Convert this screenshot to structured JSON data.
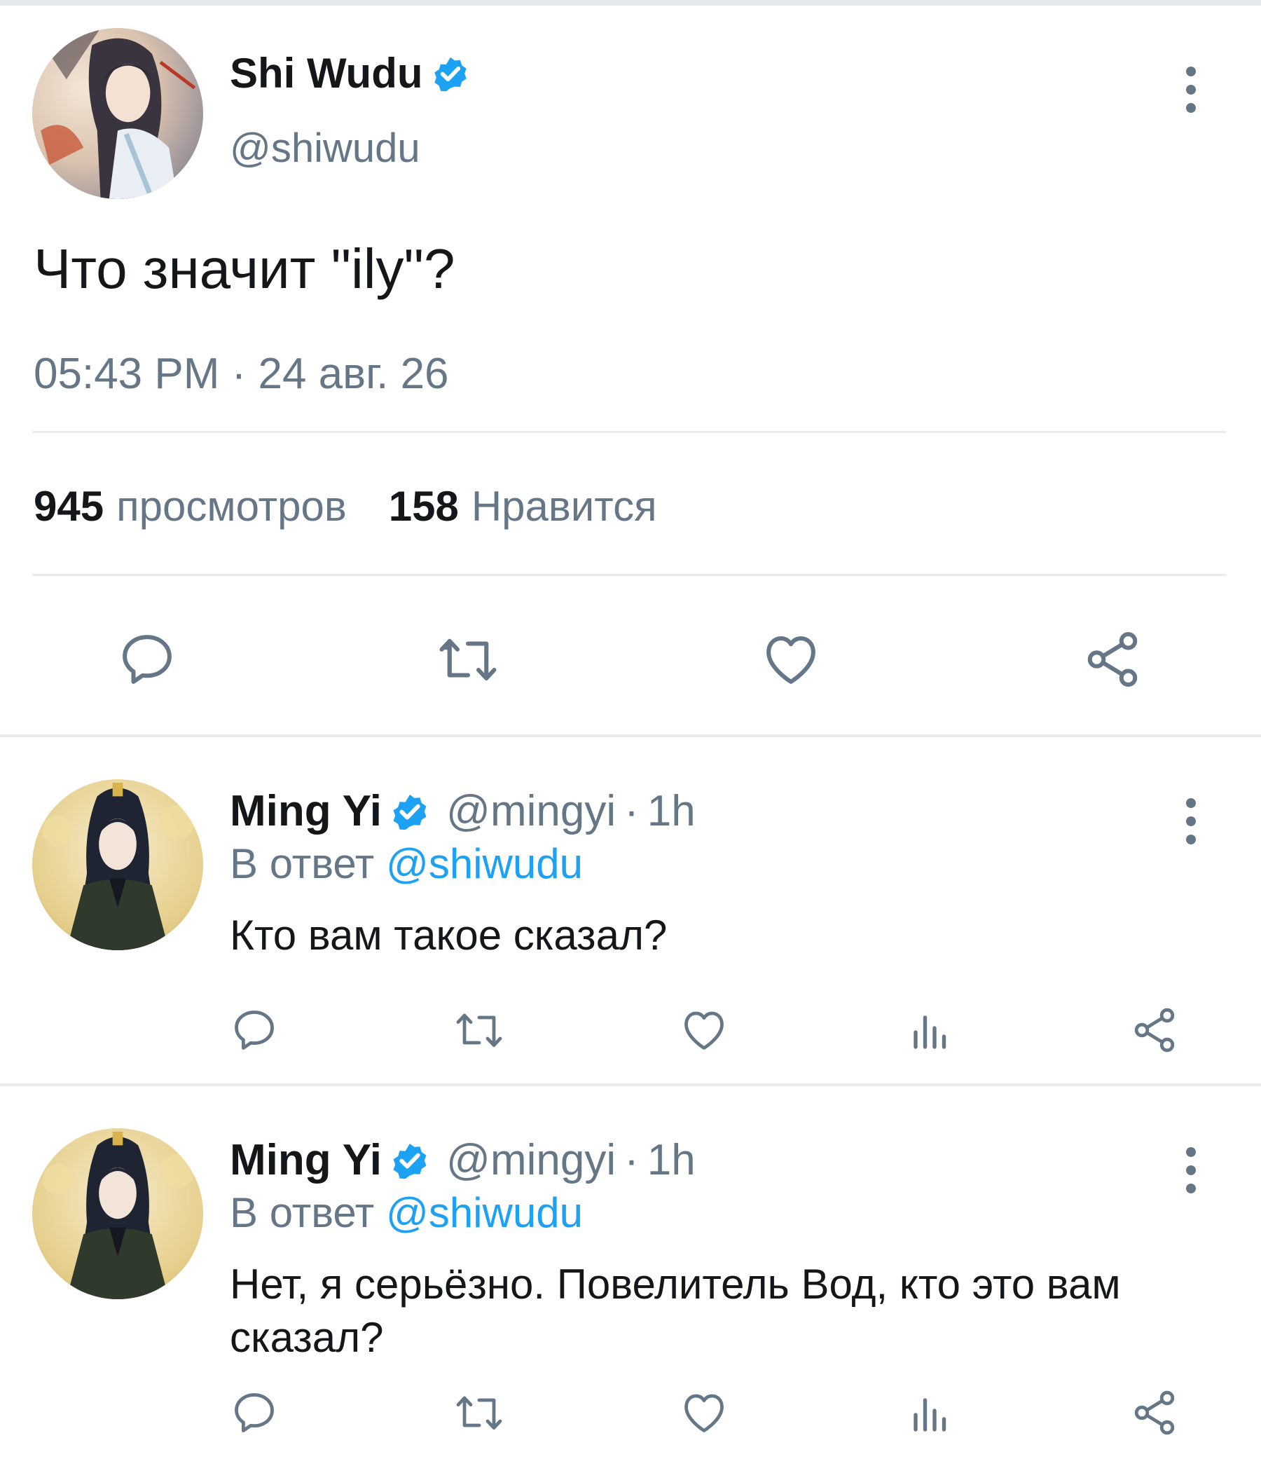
{
  "main_tweet": {
    "author_name": "Shi Wudu",
    "author_handle": "@shiwudu",
    "verified": true,
    "text": "Что значит \"ily\"?",
    "timestamp": "05:43 PM · 24 авг. 26",
    "views_count": "945",
    "views_label": "просмотров",
    "likes_count": "158",
    "likes_label": "Нравится",
    "actions": [
      "reply-icon",
      "retweet-icon",
      "like-icon",
      "share-icon"
    ]
  },
  "replies": [
    {
      "author_name": "Ming Yi",
      "author_handle": "@mingyi",
      "separator": "·",
      "age": "1h",
      "verified": true,
      "reply_to_prefix": "В ответ",
      "reply_to_handle": "@shiwudu",
      "text": "Кто вам такое сказал?",
      "actions": [
        "reply-icon",
        "retweet-icon",
        "like-icon",
        "views-icon",
        "share-icon"
      ]
    },
    {
      "author_name": "Ming Yi",
      "author_handle": "@mingyi",
      "separator": "·",
      "age": "1h",
      "verified": true,
      "reply_to_prefix": "В ответ",
      "reply_to_handle": "@shiwudu",
      "text": "Нет, я серьёзно. Повелитель Вод, кто это вам сказал?",
      "actions": [
        "reply-icon",
        "retweet-icon",
        "like-icon",
        "views-icon",
        "share-icon"
      ]
    }
  ],
  "colors": {
    "accent": "#1da1f2",
    "text_primary": "#14171a",
    "text_secondary": "#657786",
    "icon": "#657786",
    "divider": "#e6ecf0"
  }
}
